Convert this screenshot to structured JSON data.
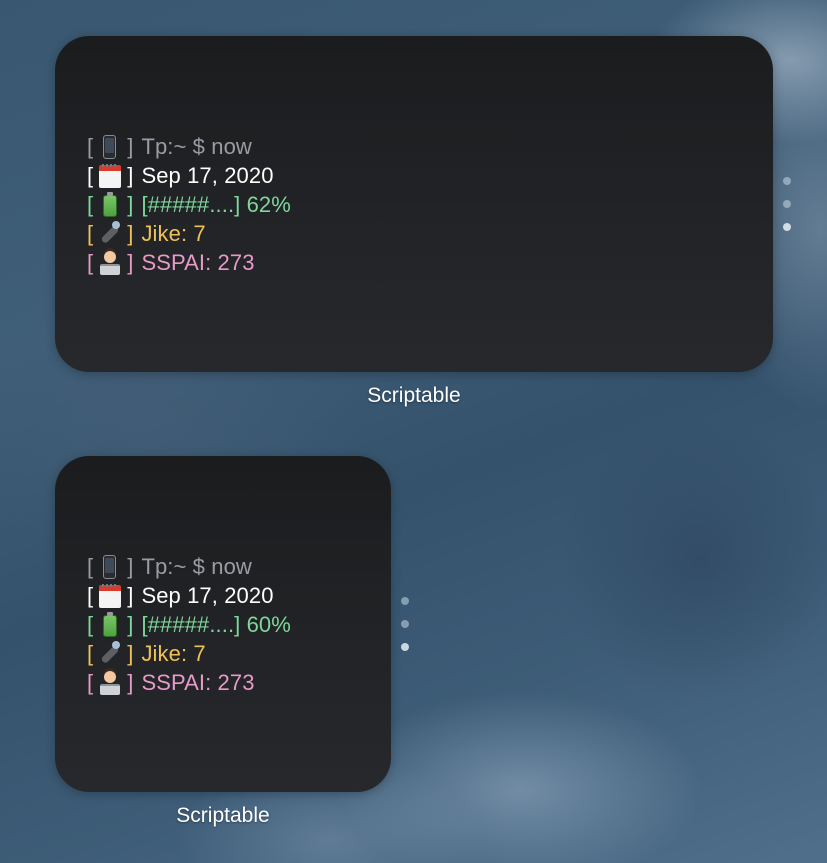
{
  "widgets": [
    {
      "app_label": "Scriptable",
      "lines": [
        {
          "icon": "phone-icon",
          "text": "Tp:~ $ now",
          "color": "#9a9ca3",
          "bracket_color": "#9a9ca3"
        },
        {
          "icon": "calendar-icon",
          "text": "Sep 17, 2020",
          "color": "#ffffff",
          "bracket_color": "#ffffff"
        },
        {
          "icon": "battery-icon",
          "text": "[#####....] 62%",
          "color": "#7fd79a",
          "bracket_color": "#7fd79a"
        },
        {
          "icon": "phone-handset-icon",
          "text": "Jike: 7",
          "color": "#f0c05a",
          "bracket_color": "#f0c05a"
        },
        {
          "icon": "technologist-icon",
          "text": "SSPAI: 273",
          "color": "#e79ac8",
          "bracket_color": "#e79ac8"
        }
      ]
    },
    {
      "app_label": "Scriptable",
      "lines": [
        {
          "icon": "phone-icon",
          "text": "Tp:~ $ now",
          "color": "#9a9ca3",
          "bracket_color": "#9a9ca3"
        },
        {
          "icon": "calendar-icon",
          "text": "Sep 17, 2020",
          "color": "#ffffff",
          "bracket_color": "#ffffff"
        },
        {
          "icon": "battery-icon",
          "text": "[#####....] 60%",
          "color": "#7fd79a",
          "bracket_color": "#7fd79a"
        },
        {
          "icon": "phone-handset-icon",
          "text": "Jike: 7",
          "color": "#f0c05a",
          "bracket_color": "#f0c05a"
        },
        {
          "icon": "technologist-icon",
          "text": "SSPAI: 273",
          "color": "#e79ac8",
          "bracket_color": "#e79ac8"
        }
      ]
    }
  ],
  "brackets": {
    "open": "[",
    "close": "]"
  }
}
